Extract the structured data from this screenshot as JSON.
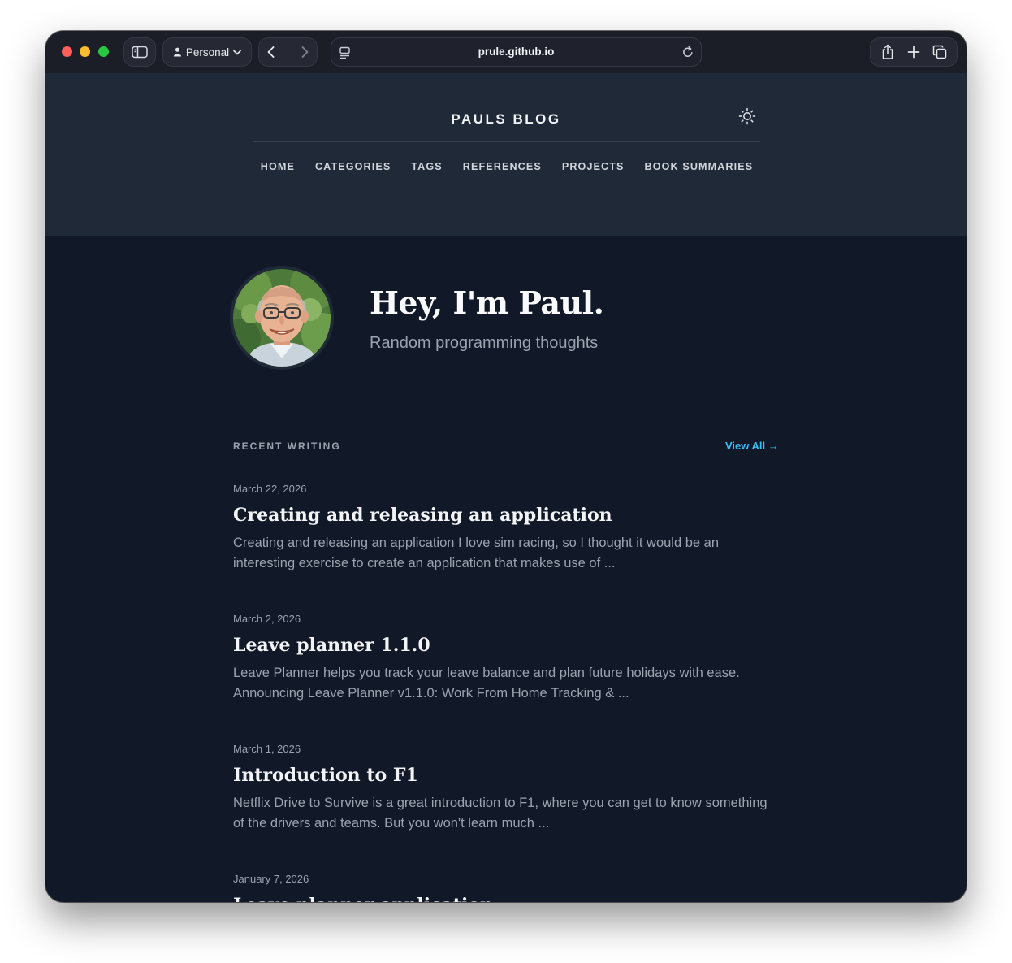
{
  "browser": {
    "profile_label": "Personal",
    "url": "prule.github.io"
  },
  "site": {
    "title": "PAULS BLOG",
    "nav": [
      "HOME",
      "CATEGORIES",
      "TAGS",
      "REFERENCES",
      "PROJECTS",
      "BOOK SUMMARIES"
    ]
  },
  "hero": {
    "title": "Hey, I'm Paul.",
    "subtitle": "Random programming thoughts"
  },
  "recent": {
    "label": "RECENT WRITING",
    "view_all": "View All →",
    "posts": [
      {
        "date": "March 22, 2026",
        "title": "Creating and releasing an application",
        "excerpt": "Creating and releasing an application I love sim racing, so I thought it would be an interesting exercise to create an application that makes use of ..."
      },
      {
        "date": "March 2, 2026",
        "title": "Leave planner 1.1.0",
        "excerpt": "Leave Planner helps you track your leave balance and plan future holidays with ease. Announcing Leave Planner v1.1.0: Work From Home Tracking & ..."
      },
      {
        "date": "March 1, 2026",
        "title": "Introduction to F1",
        "excerpt": "Netflix Drive to Survive is a great introduction to F1, where you can get to know something of the drivers and teams. But you won't learn much ..."
      },
      {
        "date": "January 7, 2026",
        "title": "Leave planner application",
        "excerpt": ""
      }
    ]
  },
  "colors": {
    "page_bg": "#111827",
    "header_bg": "#1f2937",
    "accent": "#38bdf8"
  }
}
